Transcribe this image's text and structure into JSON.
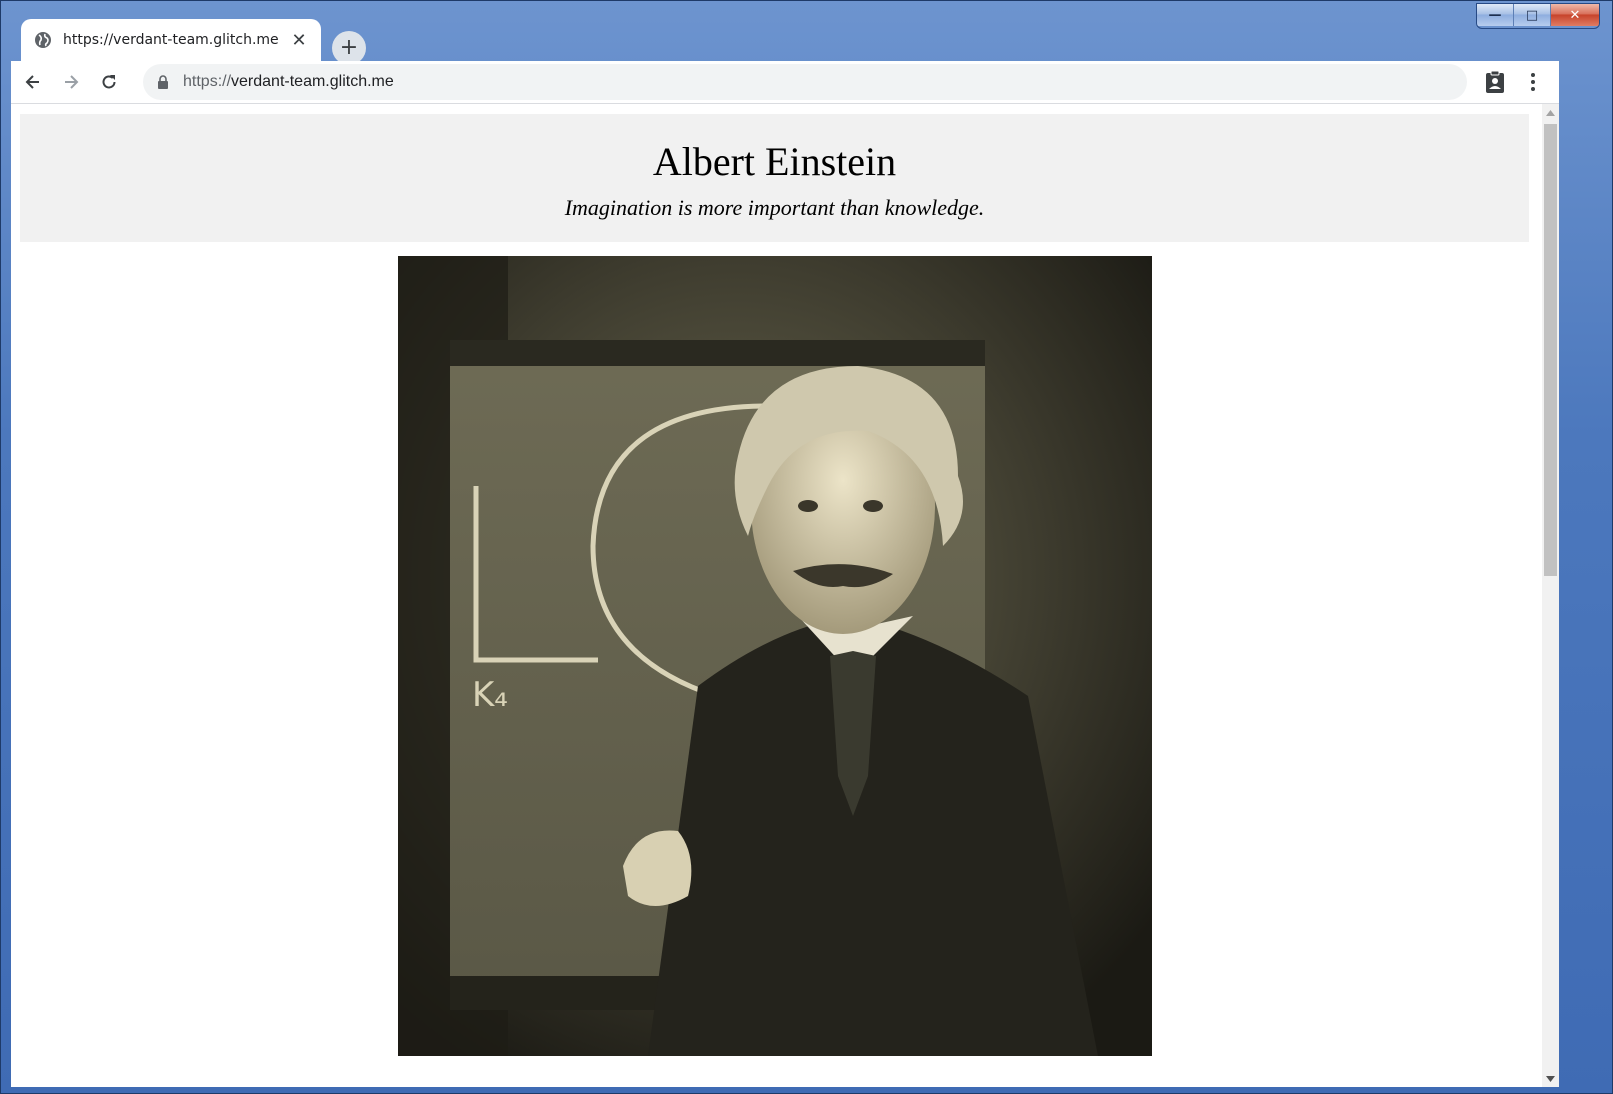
{
  "browser": {
    "tab": {
      "title": "https://verdant-team.glitch.me",
      "favicon": "globe-icon",
      "close_symbol": "✕"
    },
    "new_tab_symbol": "+",
    "address": {
      "scheme": "https://",
      "host": "verdant-team.glitch.me"
    },
    "icons": {
      "back": "back-arrow-icon",
      "forward": "forward-arrow-icon",
      "reload": "reload-icon",
      "lock": "lock-icon",
      "profile": "clipboard-account-icon",
      "menu": "kebab-menu-icon"
    }
  },
  "window_controls": {
    "minimize": "—",
    "maximize": "□",
    "close": "✕"
  },
  "page": {
    "title": "Albert Einstein",
    "quote": "Imagination is more important than knowledge.",
    "image_subject": "Sepia photograph of Albert Einstein in a suit standing before a chalkboard"
  },
  "colors": {
    "header_bg": "#f1f1f1",
    "omnibox_bg": "#f1f3f4",
    "photo_tone": "#2b2a22"
  }
}
